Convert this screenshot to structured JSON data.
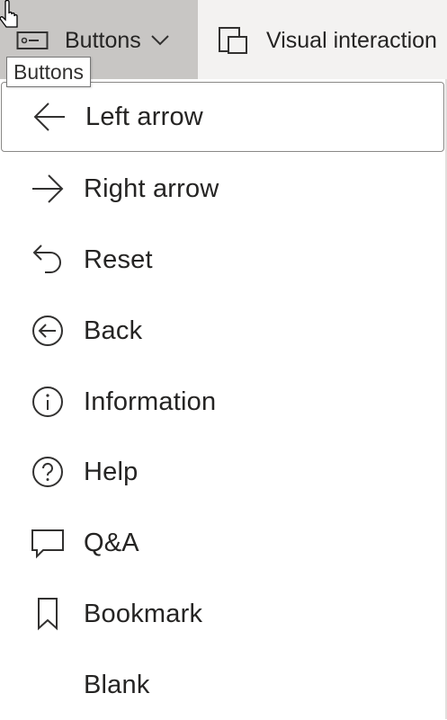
{
  "ribbon": {
    "buttons_label": "Buttons",
    "visual_interactions_label": "Visual interaction"
  },
  "tooltip": {
    "text": "Buttons"
  },
  "menu": {
    "items": [
      {
        "label": "Left arrow",
        "icon": "left-arrow-icon",
        "focused": true
      },
      {
        "label": "Right arrow",
        "icon": "right-arrow-icon"
      },
      {
        "label": "Reset",
        "icon": "reset-icon"
      },
      {
        "label": "Back",
        "icon": "back-circle-icon"
      },
      {
        "label": "Information",
        "icon": "info-icon"
      },
      {
        "label": "Help",
        "icon": "help-icon"
      },
      {
        "label": "Q&A",
        "icon": "qna-icon"
      },
      {
        "label": "Bookmark",
        "icon": "bookmark-icon"
      },
      {
        "label": "Blank",
        "icon": ""
      }
    ]
  }
}
